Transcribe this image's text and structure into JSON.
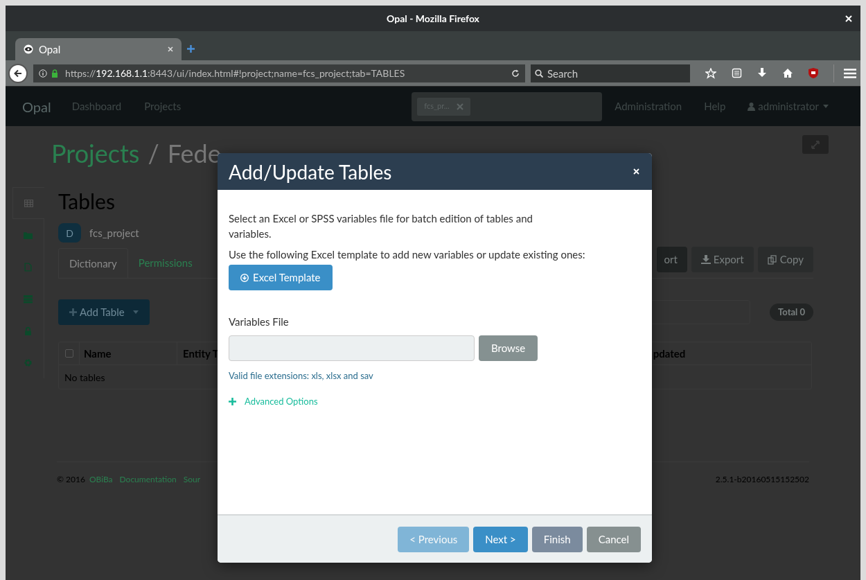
{
  "window": {
    "title": "Opal - Mozilla Firefox"
  },
  "browser_tabs": [
    {
      "label": "Opal",
      "selected": true
    }
  ],
  "address_bar": {
    "scheme": "https://",
    "host": "192.168.1.1",
    "rest": ":8443/ui/index.html#!project;name=fcs_project;tab=TABLES"
  },
  "search": {
    "placeholder": "Search"
  },
  "navbar": {
    "brand": "Opal",
    "items": [
      {
        "label": "Dashboard"
      },
      {
        "label": "Projects"
      }
    ],
    "search_token": "fcs_pr...",
    "right_items": [
      {
        "label": "Administration"
      },
      {
        "label": "Help"
      }
    ],
    "user": "administrator"
  },
  "page": {
    "breadcrumb": [
      {
        "label": "Projects",
        "kind": "link"
      },
      {
        "label": "/",
        "kind": "separator"
      },
      {
        "label": "Fede",
        "kind": "text"
      }
    ],
    "side_icons": [
      {
        "kind": "table",
        "selected": true
      },
      {
        "kind": "folder",
        "selected": false
      },
      {
        "kind": "file",
        "selected": false
      },
      {
        "kind": "server",
        "selected": false
      },
      {
        "kind": "lock",
        "selected": false
      },
      {
        "kind": "gear",
        "selected": false
      }
    ],
    "heading": "Tables",
    "badge": "D",
    "project": "fcs_project",
    "tabs": [
      {
        "label": "Dictionary",
        "selected": true
      },
      {
        "label": "Permissions",
        "selected": false
      }
    ],
    "add_button": "Add Table",
    "actions": [
      {
        "label": "ort",
        "kind": "dark"
      },
      {
        "label": "Export",
        "kind": "download"
      },
      {
        "label": "Copy",
        "kind": "copy"
      }
    ],
    "total": "Total 0",
    "table": {
      "select_all_checked": false,
      "columns": [
        {
          "label": "Name"
        },
        {
          "label": "Entity T"
        }
      ],
      "right_column": "pdated",
      "empty": "No tables"
    },
    "footer": {
      "copyright": "© 2016",
      "links": [
        "OBiBa",
        "Documentation",
        "Sour"
      ],
      "version": "2.5.1-b20160515152502"
    }
  },
  "modal": {
    "title": "Add/Update Tables",
    "intro": "Select an Excel or SPSS variables file for batch edition of tables and variables.",
    "template_hint": "Use the following Excel template to add new variables or update existing ones:",
    "template_button": "Excel Template",
    "file_label": "Variables File",
    "browse": "Browse",
    "file_hint": "Valid file extensions: xls, xlsx and sav",
    "advanced": {
      "label": "Advanced Options",
      "expanded": false
    },
    "buttons": [
      {
        "label": "< Previous",
        "kind": "primary",
        "disabled": true
      },
      {
        "label": "Next >",
        "kind": "primary",
        "disabled": false
      },
      {
        "label": "Finish",
        "kind": "slate",
        "disabled": false
      },
      {
        "label": "Cancel",
        "kind": "gray",
        "disabled": false
      }
    ]
  }
}
